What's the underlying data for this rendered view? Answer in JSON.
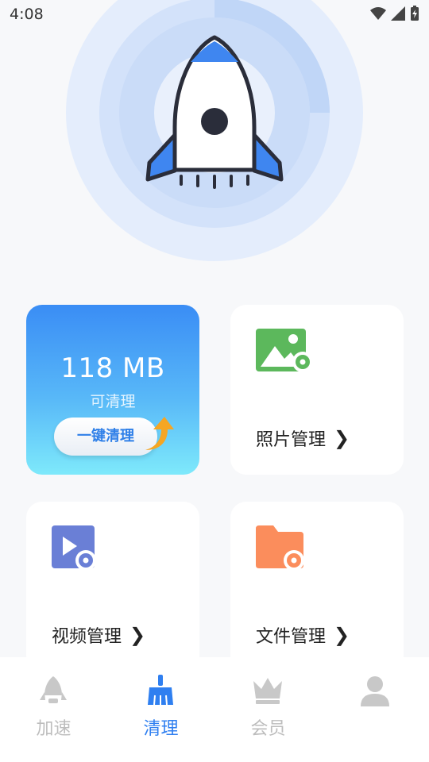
{
  "status_bar": {
    "time": "4:08"
  },
  "clean": {
    "size": "118 MB",
    "subtitle": "可清理",
    "button_label": "一键清理"
  },
  "tools": {
    "photo": {
      "label": "照片管理",
      "icon": "photo-gear-icon"
    },
    "video": {
      "label": "视频管理",
      "icon": "video-gear-icon"
    },
    "file": {
      "label": "文件管理",
      "icon": "folder-gear-icon"
    }
  },
  "tabs": [
    {
      "label": "加速",
      "icon": "rocket-icon",
      "active": false
    },
    {
      "label": "清理",
      "icon": "broom-icon",
      "active": true
    },
    {
      "label": "会员",
      "icon": "crown-icon",
      "active": false
    },
    {
      "label": "",
      "icon": "user-icon",
      "active": false
    }
  ],
  "colors": {
    "accent": "#2f7ff0",
    "inactive": "#bdbdbd",
    "photo": "#5cb85c",
    "video": "#6a7fd6",
    "file": "#fb8d5c"
  }
}
